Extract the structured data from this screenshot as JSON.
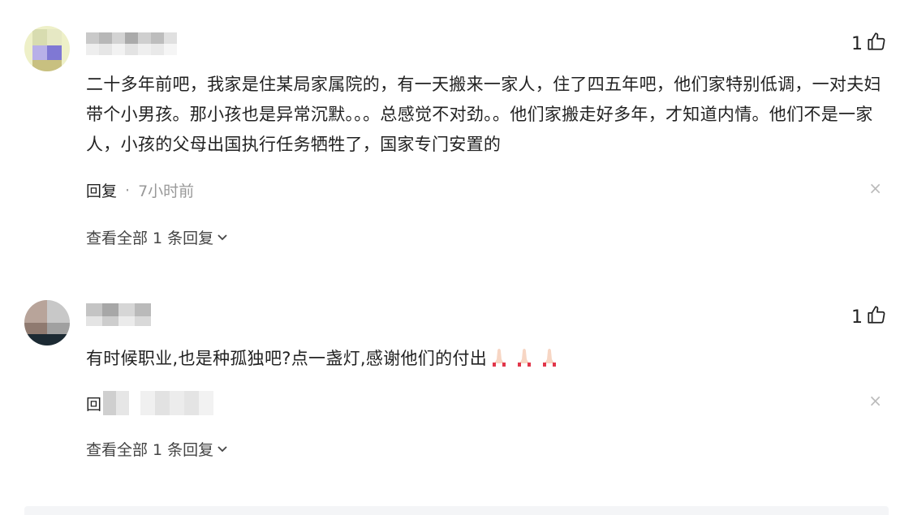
{
  "comments": [
    {
      "likes": "1",
      "text": "二十多年前吧，我家是住某局家属院的，有一天搬来一家人，住了四五年吧，他们家特别低调，一对夫妇带个小男孩。那小孩也是异常沉默。。。总感觉不对劲。。他们家搬走好多年，才知道内情。他们不是一家人，小孩的父母出国执行任务牺牲了，国家专门安置的",
      "reply_label": "回复",
      "separator": "·",
      "time": "7小时前",
      "close": "×",
      "view_all": "查看全部 1 条回复"
    },
    {
      "likes": "1",
      "text": "有时候职业,也是种孤独吧?点一盏灯,感谢他们的付出",
      "reply_label": "回",
      "close": "×",
      "view_all": "查看全部 1 条回复"
    }
  ],
  "icons": {
    "like": "thumbs-up-icon",
    "close": "close-icon",
    "expand": "chevron-down-icon",
    "emoji": "folded-hands-icon"
  }
}
